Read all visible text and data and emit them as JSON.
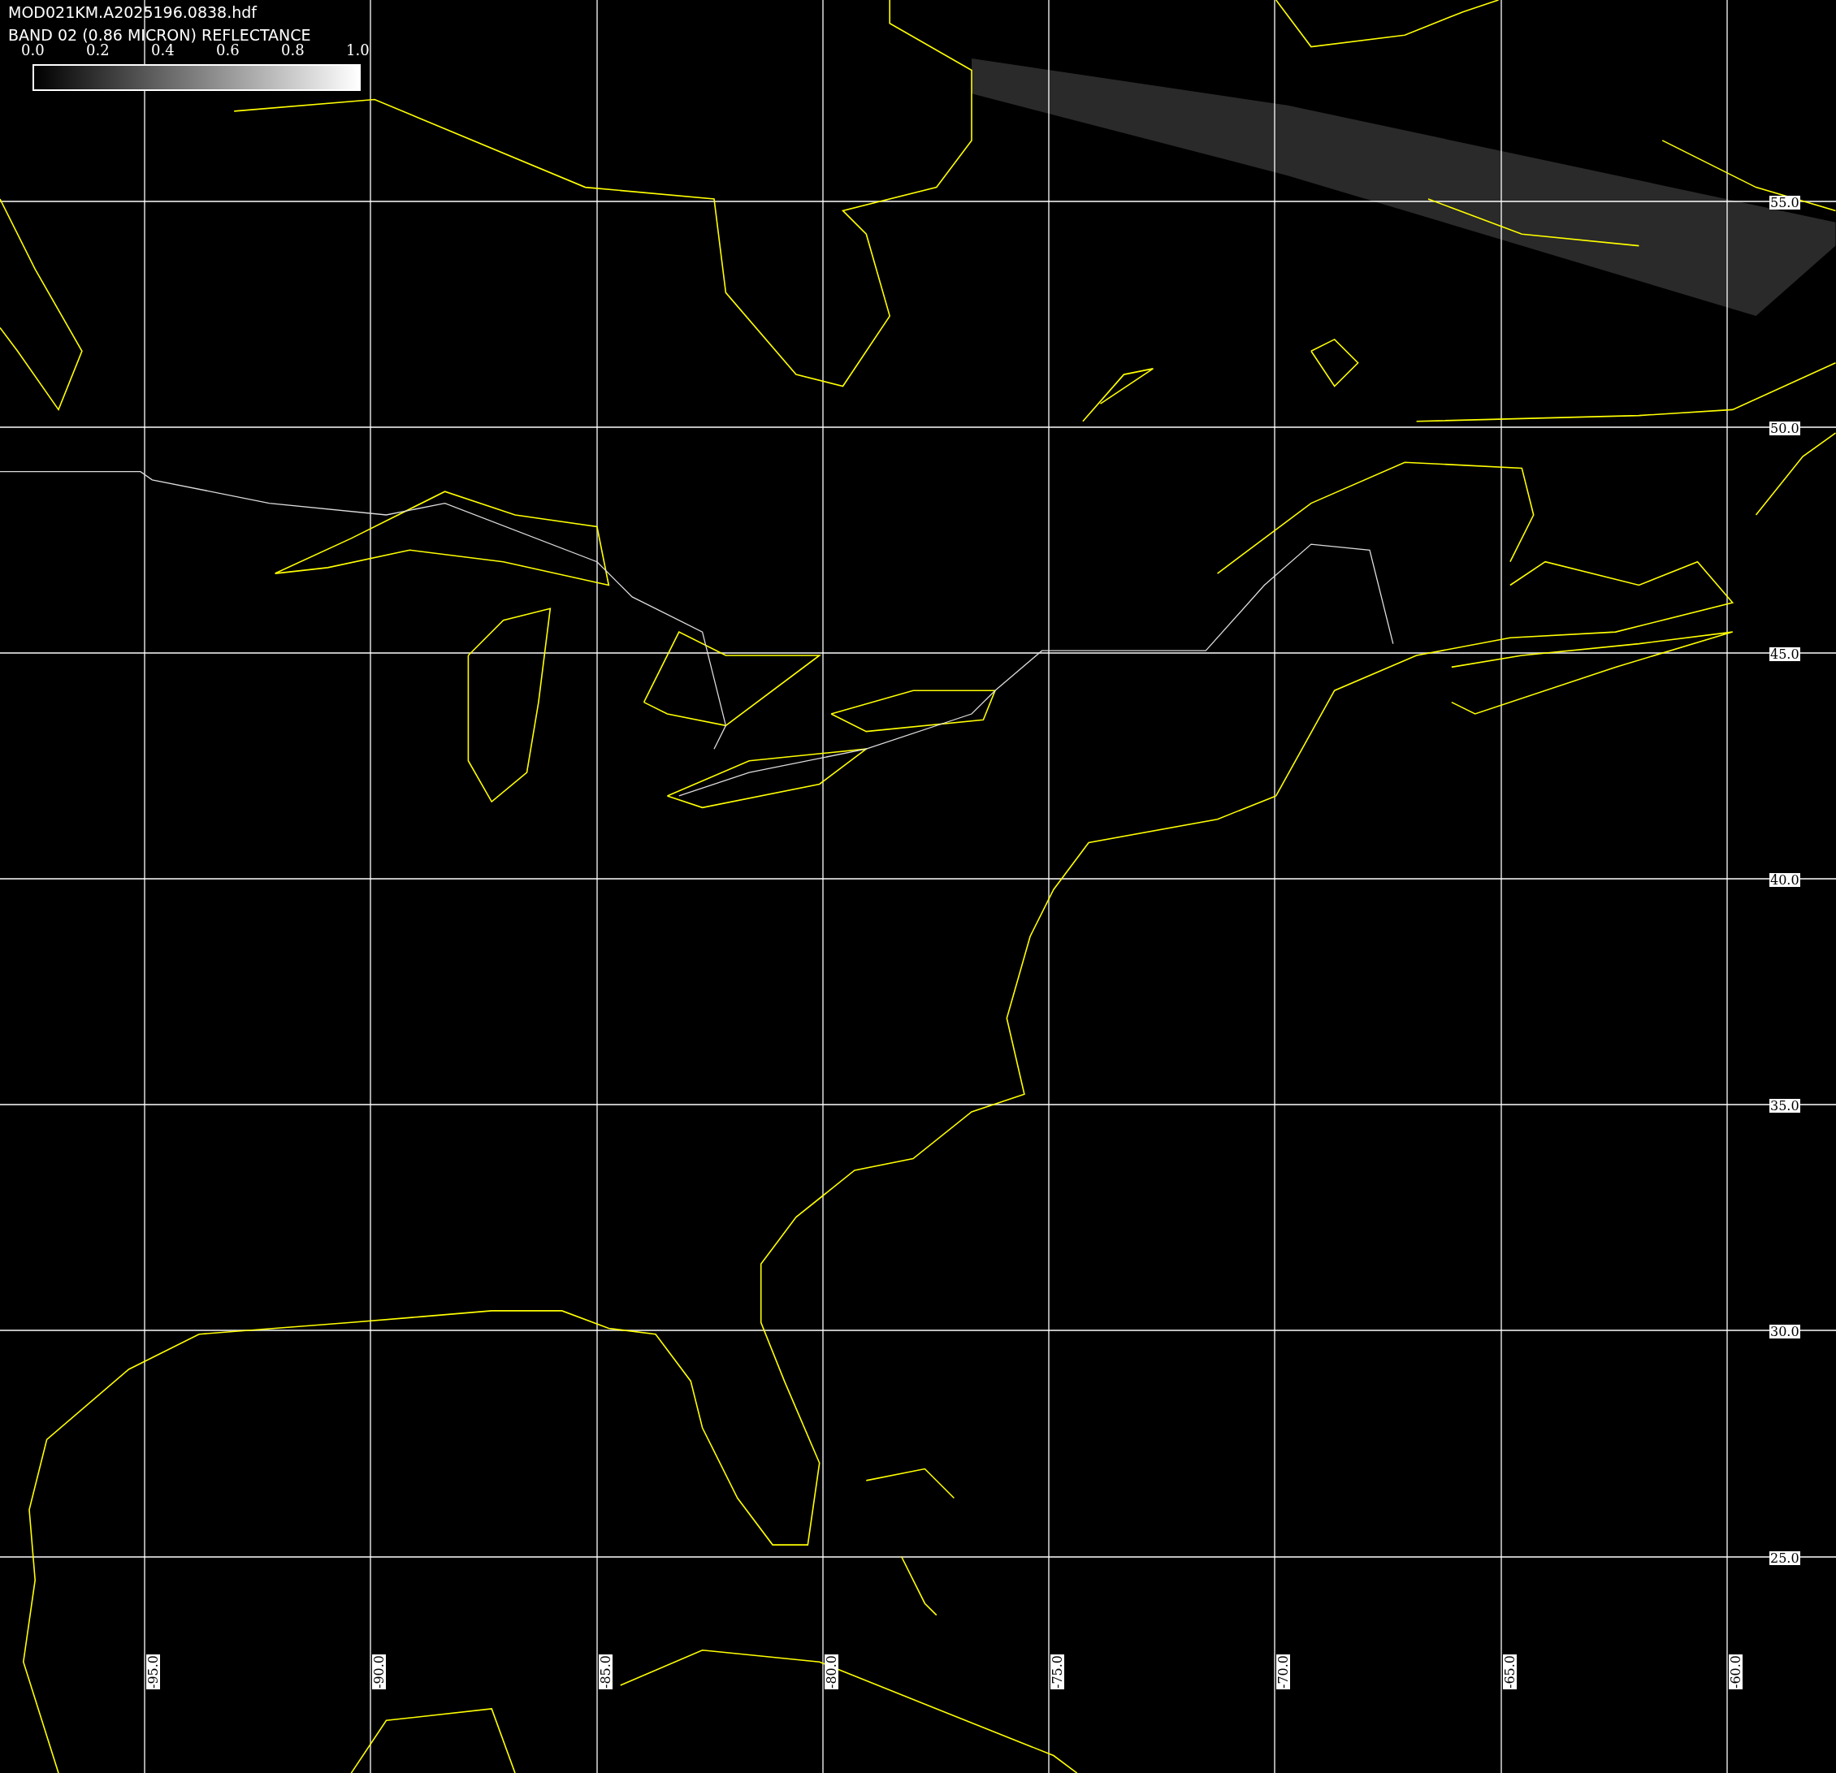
{
  "image": {
    "filename": "MOD021KM.A2025196.0838.hdf",
    "band": "BAND 02 (0.86 MICRON) REFLECTANCE"
  },
  "colorbar": {
    "ticks": [
      "0.0",
      "0.2",
      "0.4",
      "0.6",
      "0.8",
      "1.0"
    ]
  },
  "latitude_labels": [
    "55.0",
    "50.0",
    "45.0",
    "40.0",
    "35.0",
    "30.0",
    "25.0"
  ],
  "longitude_labels": [
    "-95.0",
    "-90.0",
    "-85.0",
    "-80.0",
    "-75.0",
    "-70.0",
    "-65.0",
    "-60.0"
  ]
}
